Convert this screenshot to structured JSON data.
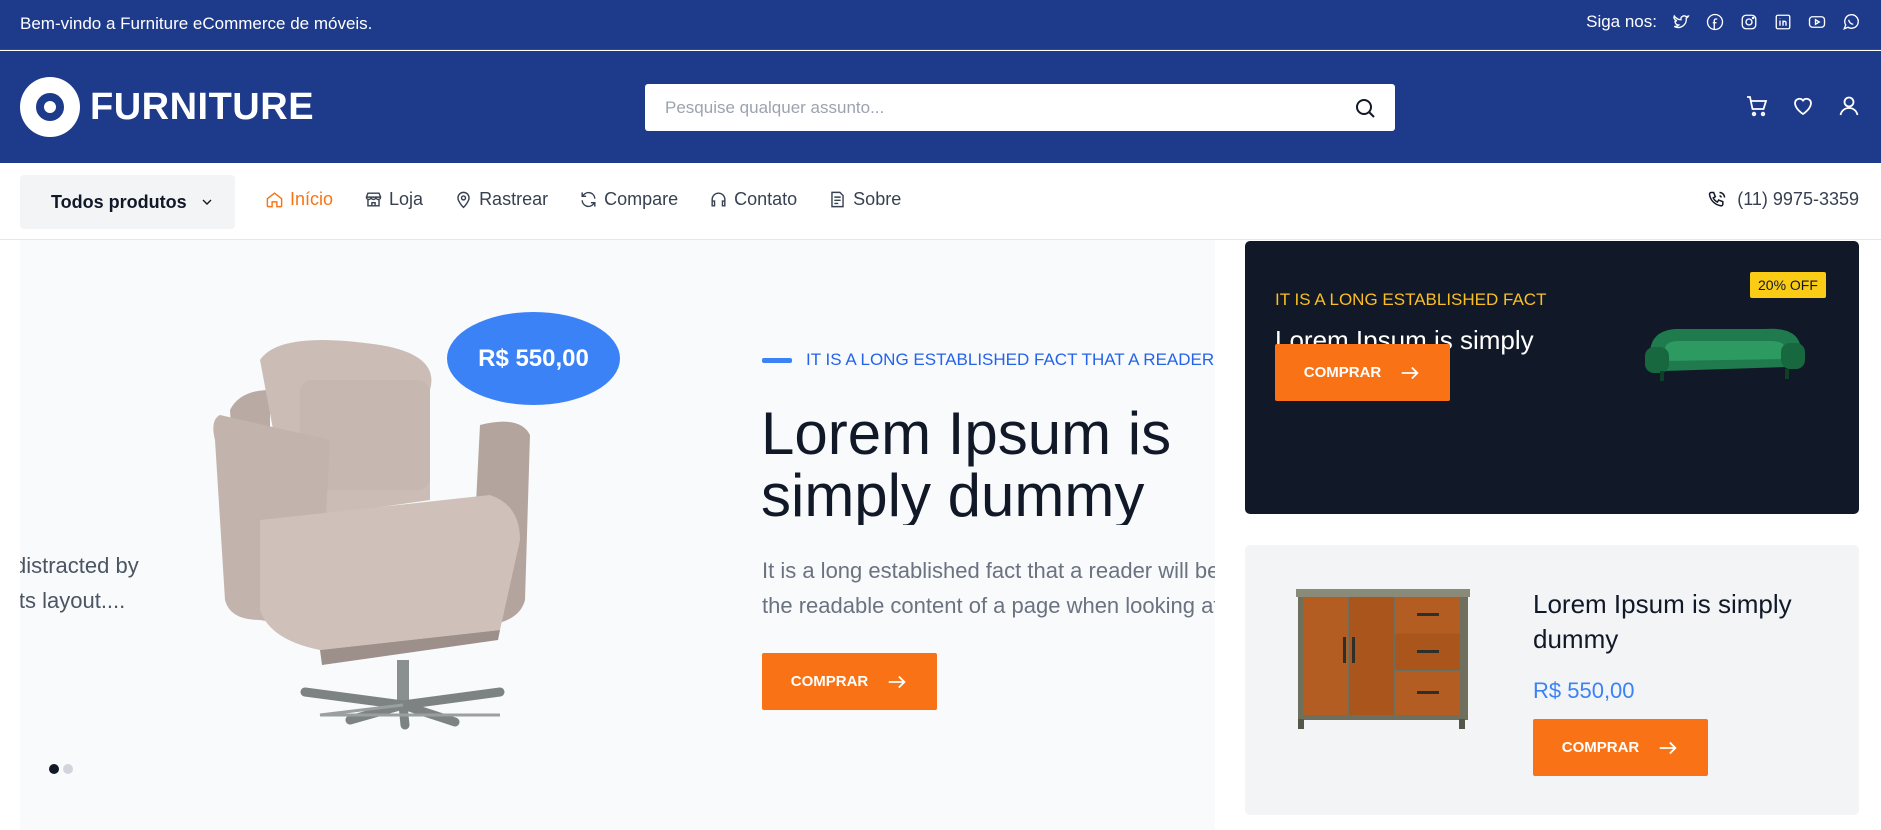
{
  "topbar": {
    "welcome": "Bem-vindo a Furniture eCommerce de móveis.",
    "follow_label": "Siga nos:",
    "social_icons": [
      "twitter-icon",
      "facebook-icon",
      "instagram-icon",
      "linkedin-icon",
      "youtube-icon",
      "whatsapp-icon"
    ]
  },
  "header": {
    "logo_text": "FURNITURE",
    "search_placeholder": "Pesquise qualquer assunto...",
    "icons": [
      "cart-icon",
      "heart-icon",
      "user-icon"
    ]
  },
  "nav": {
    "all_products": "Todos produtos",
    "items": [
      {
        "label": "Início",
        "icon": "home-icon",
        "active": true
      },
      {
        "label": "Loja",
        "icon": "store-icon",
        "active": false
      },
      {
        "label": "Rastrear",
        "icon": "map-pin-icon",
        "active": false
      },
      {
        "label": "Compare",
        "icon": "refresh-icon",
        "active": false
      },
      {
        "label": "Contato",
        "icon": "headphones-icon",
        "active": false
      },
      {
        "label": "Sobre",
        "icon": "document-icon",
        "active": false
      }
    ],
    "phone": "(11) 9975-3359"
  },
  "hero": {
    "prev_slide_text_1": "distracted by",
    "prev_slide_text_2": "its layout....",
    "price": "R$ 550,00",
    "eyebrow": "IT IS A LONG ESTABLISHED FACT THAT A READER",
    "title": "Lorem Ipsum is simply dummy",
    "desc_1": "It is a long established fact that a reader will be distracted by",
    "desc_2": "the readable content of a page when looking at its layout....",
    "button": "COMPRAR",
    "active_slide": 1,
    "slide_count": 2
  },
  "promo_dark": {
    "tag": "IT IS A LONG ESTABLISHED FACT",
    "title": "Lorem Ipsum is simply dummy",
    "badge": "20% OFF",
    "button": "COMPRAR"
  },
  "promo_light": {
    "title": "Lorem Ipsum is simply dummy",
    "price": "R$ 550,00",
    "button": "COMPRAR"
  },
  "colors": {
    "brand_navy": "#1e3a8a",
    "accent_orange": "#f97316",
    "accent_blue": "#3b82f6",
    "badge_yellow": "#facc15",
    "dark_card": "#111827"
  }
}
